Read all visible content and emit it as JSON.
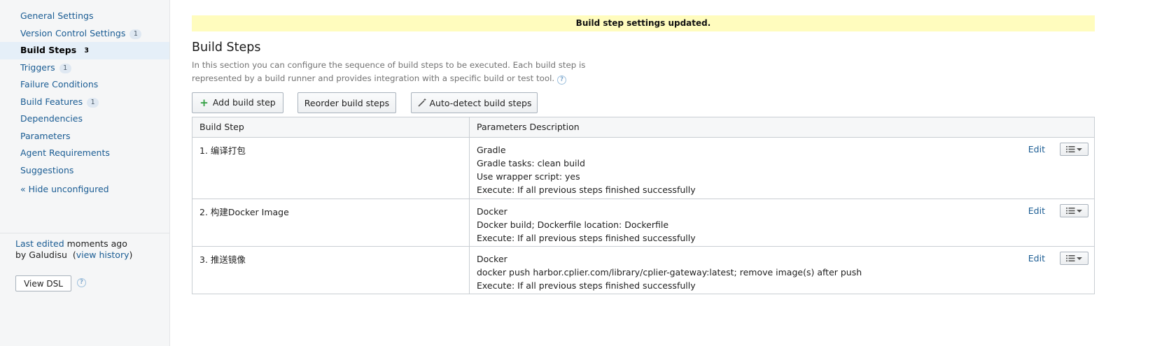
{
  "sidebar": {
    "items": [
      {
        "label": "General Settings",
        "badge": ""
      },
      {
        "label": "Version Control Settings",
        "badge": "1"
      },
      {
        "label": "Build Steps",
        "badge": "3"
      },
      {
        "label": "Triggers",
        "badge": "1"
      },
      {
        "label": "Failure Conditions",
        "badge": ""
      },
      {
        "label": "Build Features",
        "badge": "1"
      },
      {
        "label": "Dependencies",
        "badge": ""
      },
      {
        "label": "Parameters",
        "badge": ""
      },
      {
        "label": "Agent Requirements",
        "badge": ""
      },
      {
        "label": "Suggestions",
        "badge": ""
      }
    ],
    "hide_unconfigured": "« Hide unconfigured",
    "last_edited_label": "Last edited",
    "last_edited_when": "moments ago",
    "by_label": "by Galudisu",
    "view_history_prefix": "(",
    "view_history": "view history",
    "view_history_suffix": ")",
    "view_dsl": "View DSL"
  },
  "flash": "Build step settings updated.",
  "heading": "Build Steps",
  "description": "In this section you can configure the sequence of build steps to be executed. Each build step is represented by a build runner and provides integration with a specific build or test tool.",
  "buttons": {
    "add": "Add build step",
    "reorder": "Reorder build steps",
    "autodetect": "Auto-detect build steps"
  },
  "table": {
    "headers": [
      "Build Step",
      "Parameters Description"
    ],
    "rows": [
      {
        "name": "1. 编译打包",
        "params": [
          "Gradle",
          "Gradle tasks: clean build",
          "Use wrapper script: yes",
          "Execute: If all previous steps finished successfully"
        ],
        "edit": "Edit"
      },
      {
        "name": "2. 构建Docker Image",
        "params": [
          "Docker",
          "Docker build; Dockerfile location: Dockerfile",
          "Execute: If all previous steps finished successfully"
        ],
        "edit": "Edit"
      },
      {
        "name": "3. 推送镜像",
        "params": [
          "Docker",
          "docker push harbor.cplier.com/library/cplier-gateway:latest; remove image(s) after push",
          "Execute: If all previous steps finished successfully"
        ],
        "edit": "Edit"
      }
    ]
  },
  "colors": {
    "link": "#1a5c93",
    "flash_bg": "#fffcbe",
    "active_nav_bg": "#e5eff8",
    "add_icon": "#2f9e3f"
  },
  "icons": {
    "add": "plus-icon",
    "autodetect": "magic-wand-icon",
    "help": "help-circle-icon",
    "row_menu": "list-menu-icon"
  }
}
